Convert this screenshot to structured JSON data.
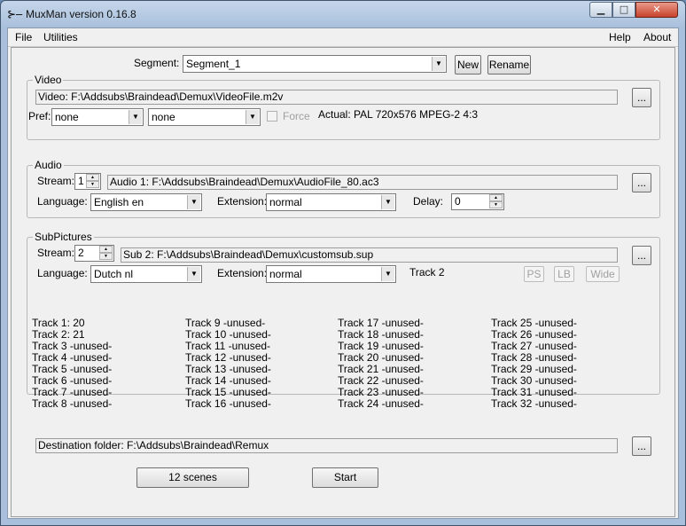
{
  "window": {
    "title": "MuxMan version 0.16.8",
    "app_icon": "muxman-icon"
  },
  "menu": {
    "file": "File",
    "utilities": "Utilities",
    "help": "Help",
    "about": "About"
  },
  "segment": {
    "label": "Segment:",
    "value": "Segment_1",
    "new_label": "New",
    "rename_label": "Rename"
  },
  "video": {
    "title": "Video",
    "file": "Video: F:\\Addsubs\\Braindead\\Demux\\VideoFile.m2v",
    "browse": "...",
    "pref_label": "Pref:",
    "pref1": "none",
    "pref2": "none",
    "force_label": "Force",
    "actual": "Actual: PAL  720x576  MPEG-2  4:3"
  },
  "audio": {
    "title": "Audio",
    "stream_label": "Stream:",
    "stream_value": "1",
    "file": "Audio 1: F:\\Addsubs\\Braindead\\Demux\\AudioFile_80.ac3",
    "browse": "...",
    "language_label": "Language:",
    "language_value": "English en",
    "extension_label": "Extension:",
    "extension_value": "normal",
    "delay_label": "Delay:",
    "delay_value": "0"
  },
  "subpictures": {
    "title": "SubPictures",
    "stream_label": "Stream:",
    "stream_value": "2",
    "file": "Sub 2: F:\\Addsubs\\Braindead\\Demux\\customsub.sup",
    "browse": "...",
    "language_label": "Language:",
    "language_value": "Dutch nl",
    "extension_label": "Extension:",
    "extension_value": "normal",
    "track_label": "Track 2",
    "ps_label": "PS",
    "lb_label": "LB",
    "wide_label": "Wide",
    "tracks": [
      [
        "Track 1:  20",
        "Track 2:  21",
        "Track 3  -unused-",
        "Track 4  -unused-",
        "Track 5  -unused-",
        "Track 6  -unused-",
        "Track 7  -unused-",
        "Track 8  -unused-"
      ],
      [
        "Track 9  -unused-",
        "Track 10  -unused-",
        "Track 11  -unused-",
        "Track 12  -unused-",
        "Track 13  -unused-",
        "Track 14  -unused-",
        "Track 15  -unused-",
        "Track 16  -unused-"
      ],
      [
        "Track 17  -unused-",
        "Track 18  -unused-",
        "Track 19  -unused-",
        "Track 20  -unused-",
        "Track 21  -unused-",
        "Track 22  -unused-",
        "Track 23  -unused-",
        "Track 24  -unused-"
      ],
      [
        "Track 25  -unused-",
        "Track 26  -unused-",
        "Track 27  -unused-",
        "Track 28  -unused-",
        "Track 29  -unused-",
        "Track 30  -unused-",
        "Track 31  -unused-",
        "Track 32  -unused-"
      ]
    ]
  },
  "destination": {
    "text": "Destination folder: F:\\Addsubs\\Braindead\\Remux",
    "browse": "..."
  },
  "actions": {
    "scenes_label": "12 scenes",
    "start_label": "Start"
  }
}
